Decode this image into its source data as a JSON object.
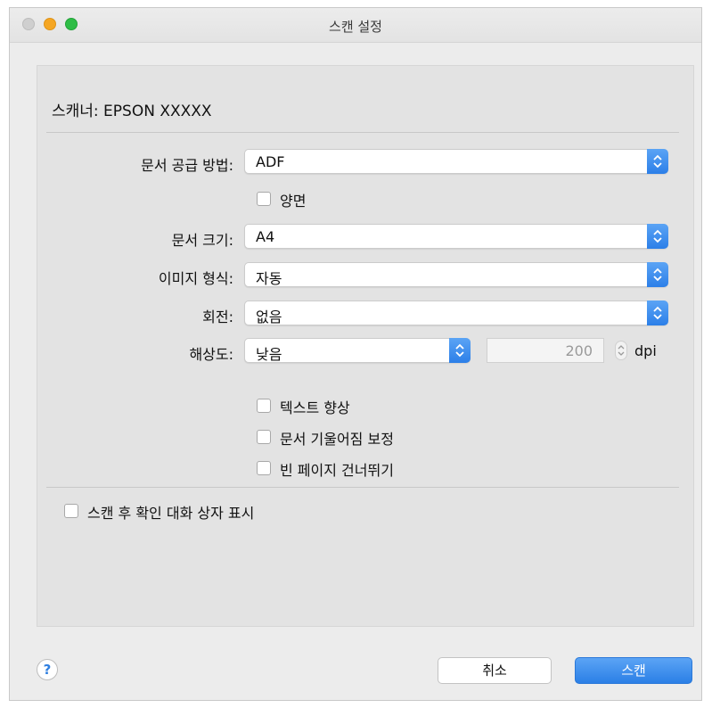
{
  "window": {
    "title": "스캔 설정"
  },
  "scanner": {
    "label": "스캐너: EPSON XXXXX"
  },
  "form": {
    "source": {
      "label": "문서 공급 방법:",
      "value": "ADF"
    },
    "duplex": {
      "label": "양면",
      "checked": false
    },
    "size": {
      "label": "문서 크기:",
      "value": "A4"
    },
    "format": {
      "label": "이미지 형식:",
      "value": "자동"
    },
    "rotation": {
      "label": "회전:",
      "value": "없음"
    },
    "resolution": {
      "label": "해상도:",
      "value": "낮음",
      "dpi_value": "200",
      "unit": "dpi"
    },
    "options": [
      {
        "label": "텍스트 향상",
        "checked": false
      },
      {
        "label": "문서 기울어짐 보정",
        "checked": false
      },
      {
        "label": "빈 페이지 건너뛰기",
        "checked": false
      }
    ],
    "confirm": {
      "label": "스캔 후 확인 대화 상자 표시",
      "checked": false
    }
  },
  "footer": {
    "help": "?",
    "cancel": "취소",
    "scan": "스캔"
  },
  "colors": {
    "accent": "#2c7fe8",
    "close": "#cfcfcf",
    "minimize": "#f5a623",
    "maximize": "#2ebd46"
  }
}
